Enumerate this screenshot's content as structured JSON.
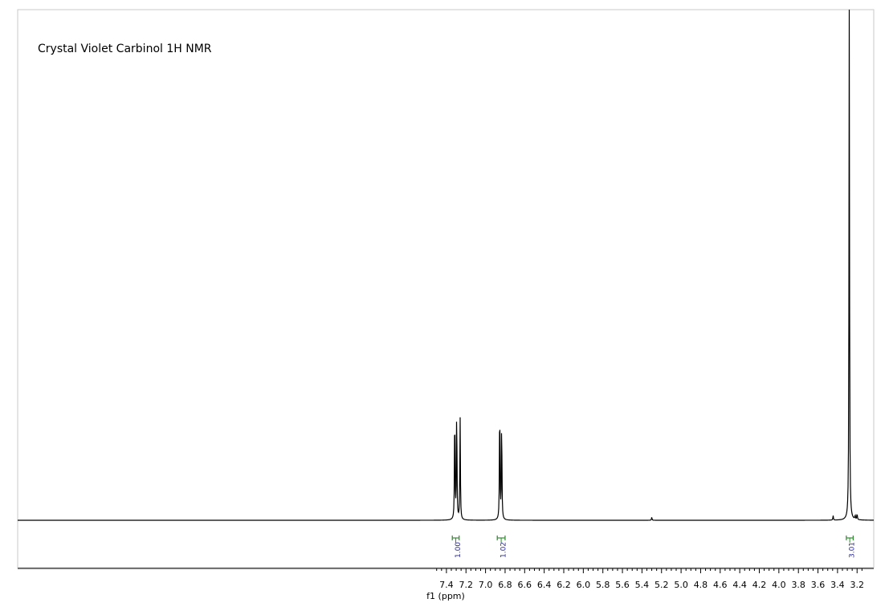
{
  "chart_data": {
    "type": "line",
    "title": "Crystal Violet Carbinol   1H NMR",
    "xlabel": "f1 (ppm)",
    "ylabel": "",
    "x_reversed": true,
    "xlim": [
      7.5,
      3.13
    ],
    "ylim": [
      0,
      1
    ],
    "grid": false,
    "x_ticks": [
      "7.4",
      "7.2",
      "7.0",
      "6.8",
      "6.6",
      "6.4",
      "6.2",
      "6.0",
      "5.8",
      "5.6",
      "5.4",
      "5.2",
      "5.0",
      "4.8",
      "4.6",
      "4.4",
      "4.2",
      "4.0",
      "3.8",
      "3.6",
      "3.4",
      "3.2"
    ],
    "series": [
      {
        "peaks": [
          {
            "ppm": 7.315,
            "height": 0.226
          },
          {
            "ppm": 7.295,
            "height": 0.226
          },
          {
            "ppm": 7.26,
            "height": 0.203
          },
          {
            "ppm": 6.855,
            "height": 0.239
          },
          {
            "ppm": 6.835,
            "height": 0.202
          },
          {
            "ppm": 5.3,
            "height": 0.006
          },
          {
            "ppm": 3.445,
            "height": 0.009
          },
          {
            "ppm": 3.28,
            "height": 1.05
          },
          {
            "ppm": 3.22,
            "height": 0.008
          },
          {
            "ppm": 3.2,
            "height": 0.012
          }
        ]
      }
    ],
    "integrals": [
      {
        "ppm_start": 7.34,
        "ppm_end": 7.27,
        "label": "1.00"
      },
      {
        "ppm_start": 6.88,
        "ppm_end": 6.8,
        "label": "1.02"
      },
      {
        "ppm_start": 3.31,
        "ppm_end": 3.24,
        "label": "3.01"
      }
    ]
  }
}
